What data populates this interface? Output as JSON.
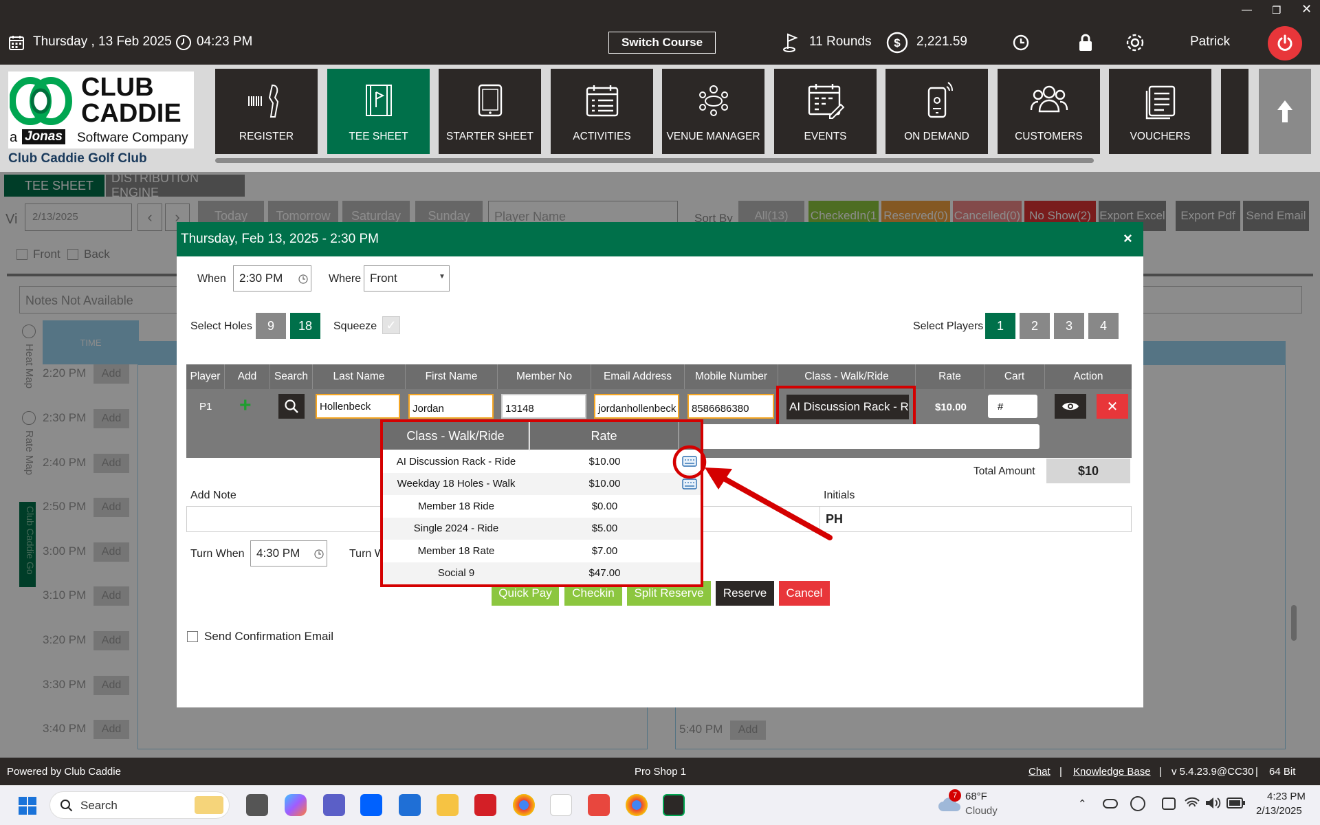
{
  "topbar": {
    "date": "Thursday ,  13 Feb 2025",
    "time": "04:23 PM",
    "switch_course": "Switch Course",
    "rounds": "11 Rounds",
    "balance": "2,221.59",
    "user": "Patrick"
  },
  "logo": {
    "line1": "CLUB",
    "line2": "CADDIE",
    "tag_a": "a",
    "tag_brand": "Jonas",
    "tag_rest": "Software Company",
    "club_name": "Club Caddie Golf Club"
  },
  "nav": [
    {
      "label": "REGISTER",
      "icon": "barcode-scanner-icon"
    },
    {
      "label": "TEE SHEET",
      "icon": "tee-sheet-icon",
      "active": true
    },
    {
      "label": "STARTER SHEET",
      "icon": "tablet-icon"
    },
    {
      "label": "ACTIVITIES",
      "icon": "calendar-list-icon"
    },
    {
      "label": "VENUE MANAGER",
      "icon": "meeting-icon"
    },
    {
      "label": "EVENTS",
      "icon": "calendar-edit-icon"
    },
    {
      "label": "ON DEMAND",
      "icon": "mobile-icon"
    },
    {
      "label": "CUSTOMERS",
      "icon": "users-icon"
    },
    {
      "label": "VOUCHERS",
      "icon": "voucher-icon"
    }
  ],
  "bg": {
    "tab1": "TEE SHEET",
    "tab2": "DISTRIBUTION ENGINE",
    "view_prefix": "Vi",
    "date_value": "2/13/2025",
    "day_buttons": [
      "Today",
      "Tomorrow",
      "Saturday",
      "Sunday"
    ],
    "player_name_placeholder": "Player Name",
    "sort_by": "Sort By",
    "filters": [
      "All(13)",
      "CheckedIn(1",
      "Reserved(0)",
      "Cancelled(0)",
      "No Show(2)",
      "Export Excel",
      "Export Pdf",
      "Send Email"
    ],
    "front": "Front",
    "back": "Back",
    "notes": "Notes Not Available",
    "time_header": "TIME",
    "heat_map": "Heat Map",
    "rate_map": "Rate Map",
    "club_vertical": "Club Caddie Go",
    "slots": [
      "2:20 PM",
      "2:30 PM",
      "2:40 PM",
      "2:50 PM",
      "3:00 PM",
      "3:10 PM",
      "3:20 PM",
      "3:30 PM",
      "3:40 PM"
    ],
    "slot_add": "Add",
    "right_slot": "5:40 PM"
  },
  "modal": {
    "title": "Thursday, Feb 13, 2025 - 2:30 PM",
    "close": "×",
    "when_label": "When",
    "when_value": "2:30 PM",
    "where_label": "Where",
    "where_value": "Front",
    "select_holes_label": "Select Holes",
    "holes": [
      "9",
      "18"
    ],
    "squeeze_label": "Squeeze",
    "select_players_label": "Select Players",
    "players": [
      "1",
      "2",
      "3",
      "4"
    ],
    "table_headers": [
      "Player",
      "Add",
      "Search",
      "Last Name",
      "First Name",
      "Member No",
      "Email Address",
      "Mobile Number",
      "Class - Walk/Ride",
      "Rate",
      "Cart",
      "Action"
    ],
    "row": {
      "player": "P1",
      "last_name": "Hollenbeck",
      "first_name": "Jordan",
      "member_no": "13148",
      "email": "jordanhollenbeck",
      "mobile": "8586686380",
      "class": "AI Discussion Rack - Ride",
      "rate": "$10.00",
      "cart": "#"
    },
    "total_label": "Total Amount",
    "total_value": "$10",
    "add_note_label": "Add Note",
    "initials_label": "Initials",
    "initials_value": "PH",
    "turn_when_label": "Turn When",
    "turn_when_value": "4:30 PM",
    "turn_where_label": "Turn W",
    "buttons": [
      "Quick Pay",
      "Checkin",
      "Split Reserve",
      "Reserve",
      "Cancel"
    ],
    "send_confirmation": "Send Confirmation Email"
  },
  "dropdown": {
    "headers": [
      "Class - Walk/Ride",
      "Rate"
    ],
    "rows": [
      {
        "class": "AI Discussion Rack - Ride",
        "rate": "$10.00",
        "icon": true
      },
      {
        "class": "Weekday 18 Holes - Walk",
        "rate": "$10.00",
        "icon": true
      },
      {
        "class": "Member 18 Ride",
        "rate": "$0.00",
        "icon": false
      },
      {
        "class": "Single 2024 - Ride",
        "rate": "$5.00",
        "icon": false
      },
      {
        "class": "Member 18 Rate",
        "rate": "$7.00",
        "icon": false
      },
      {
        "class": "Social 9",
        "rate": "$47.00",
        "icon": false
      }
    ]
  },
  "footer": {
    "powered": "Powered by Club Caddie",
    "location": "Pro Shop 1",
    "chat": "Chat",
    "kb": "Knowledge Base",
    "version": "v 5.4.23.9@CC30",
    "bits": "64 Bit",
    "sep": "|"
  },
  "taskbar": {
    "search": "Search",
    "weather_temp": "68°F",
    "weather_desc": "Cloudy",
    "weather_badge": "7",
    "time": "4:23 PM",
    "date": "2/13/2025"
  },
  "colors": {
    "brand_green": "#00704a",
    "dark": "#2c2826",
    "accent_red": "#d40000"
  }
}
